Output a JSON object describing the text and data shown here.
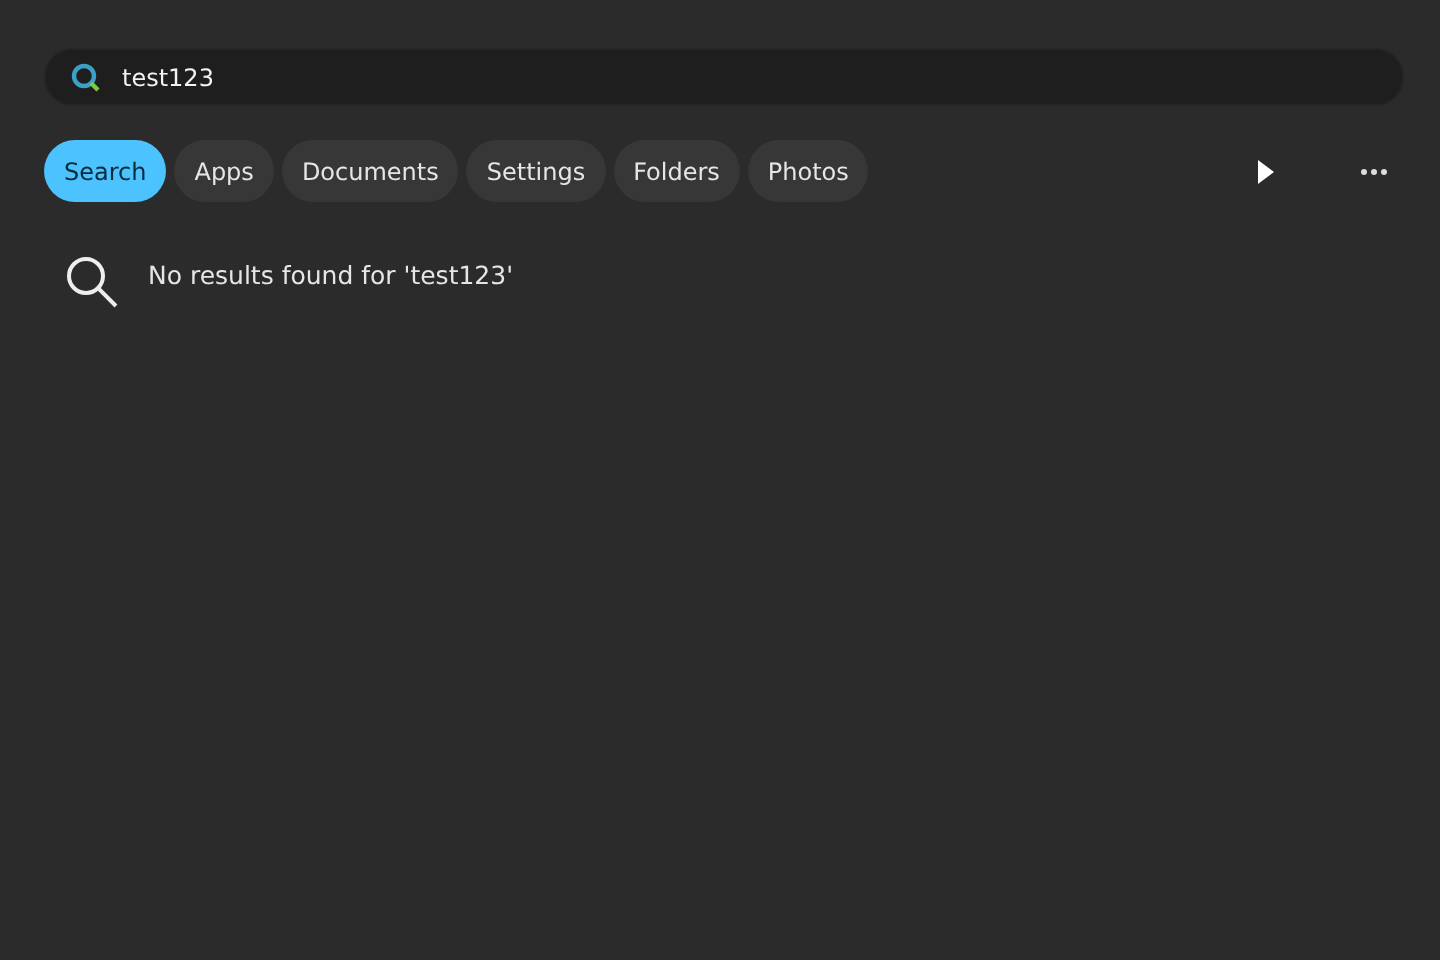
{
  "search": {
    "value": "test123"
  },
  "filters": [
    {
      "label": "Search",
      "selected": true
    },
    {
      "label": "Apps",
      "selected": false
    },
    {
      "label": "Documents",
      "selected": false
    },
    {
      "label": "Settings",
      "selected": false
    },
    {
      "label": "Folders",
      "selected": false
    },
    {
      "label": "Photos",
      "selected": false
    }
  ],
  "message": "No results found for 'test123'"
}
